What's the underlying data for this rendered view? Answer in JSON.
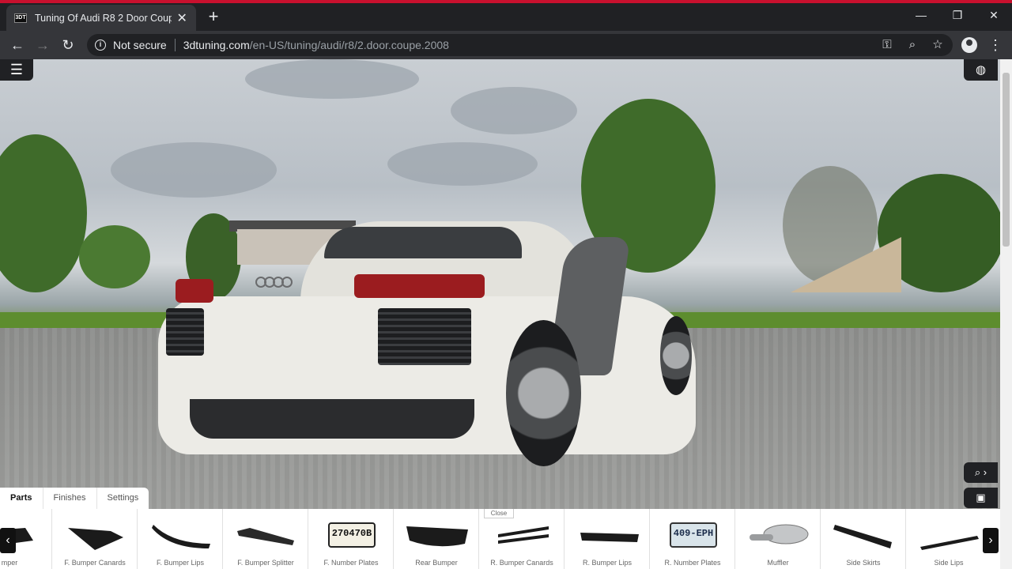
{
  "browser": {
    "tab_title": "Tuning Of Audi R8 2 Door Coupe",
    "favicon_text": "3DT",
    "security_label": "Not secure",
    "url_host": "3dtuning.com",
    "url_path": "/en-US/tuning/audi/r8/2.door.coupe.2008"
  },
  "icons": {
    "tab_close": "close-icon",
    "new_tab": "plus-icon",
    "back": "arrow-left-icon",
    "forward": "arrow-right-icon",
    "reload": "reload-icon",
    "key": "key-icon",
    "zoom": "magnifier-icon",
    "star": "star-icon",
    "profile": "account-icon",
    "menu": "kebab-menu-icon",
    "hamburger": "hamburger-icon",
    "globe": "globe-icon",
    "save": "save-icon"
  },
  "panel": {
    "tabs": [
      {
        "label": "Parts",
        "active": true
      },
      {
        "label": "Finishes",
        "active": false
      },
      {
        "label": "Settings",
        "active": false
      }
    ],
    "close_label": "Close",
    "parts": [
      {
        "label": "mper"
      },
      {
        "label": "F. Bumper Canards"
      },
      {
        "label": "F. Bumper Lips"
      },
      {
        "label": "F. Bumper Splitter"
      },
      {
        "label": "F. Number Plates",
        "plate_text": "270470B"
      },
      {
        "label": "Rear Bumper"
      },
      {
        "label": "R. Bumper Canards"
      },
      {
        "label": "R. Bumper Lips"
      },
      {
        "label": "R. Number Plates",
        "plate_text": "409-EPH"
      },
      {
        "label": "Muffler"
      },
      {
        "label": "Side Skirts"
      },
      {
        "label": "Side Lips"
      }
    ]
  },
  "colors": {
    "accent_red": "#c8102e",
    "chrome_dark": "#202124",
    "chrome_toolbar": "#35363a"
  }
}
